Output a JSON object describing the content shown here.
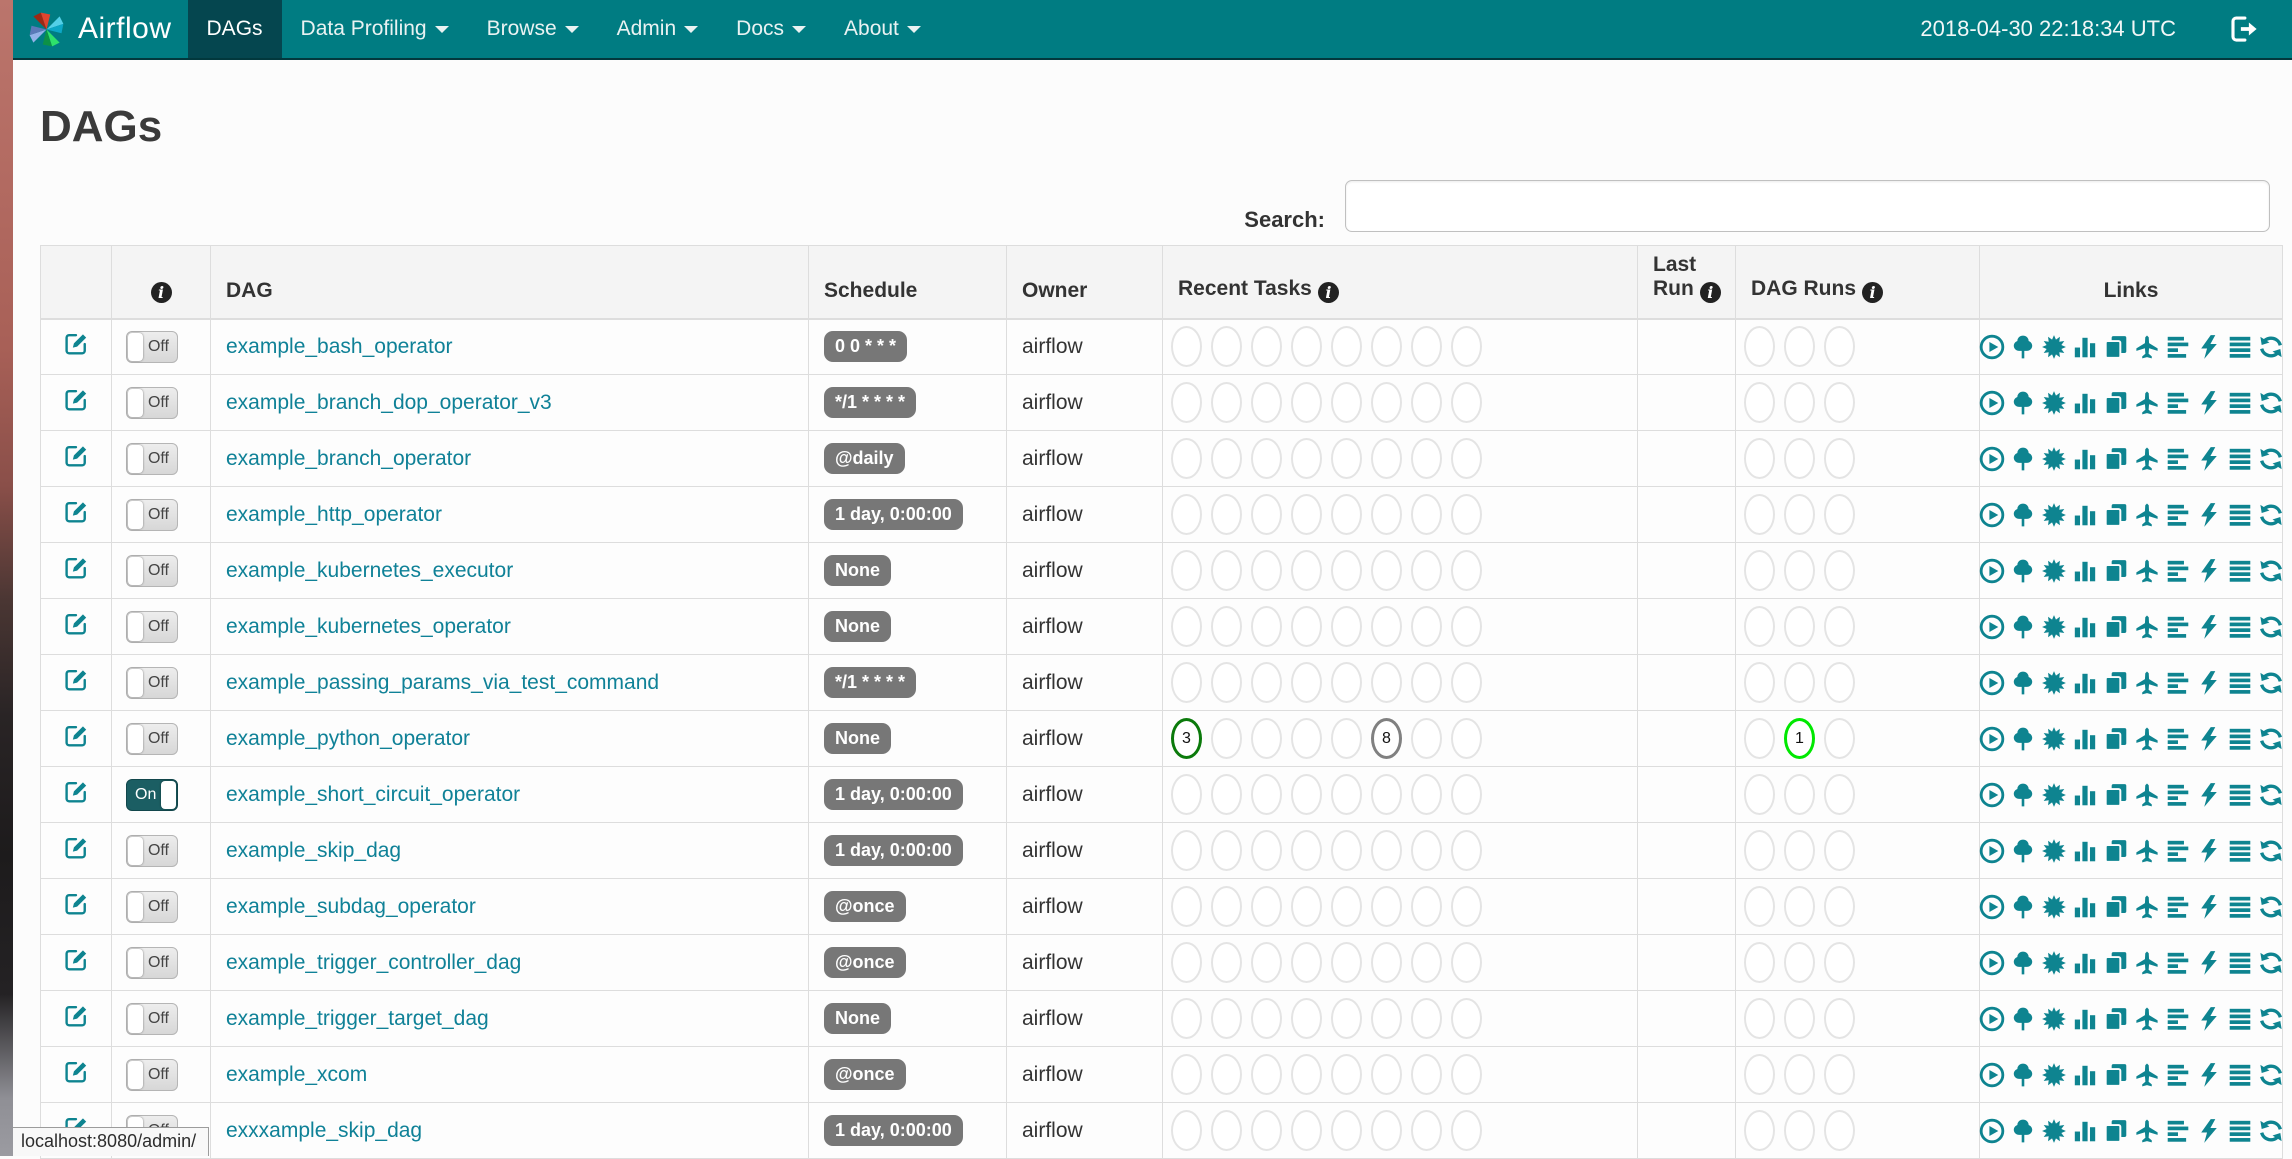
{
  "navbar": {
    "brand": "Airflow",
    "items": [
      {
        "label": "DAGs",
        "active": true,
        "caret": false
      },
      {
        "label": "Data Profiling",
        "active": false,
        "caret": true
      },
      {
        "label": "Browse",
        "active": false,
        "caret": true
      },
      {
        "label": "Admin",
        "active": false,
        "caret": true
      },
      {
        "label": "Docs",
        "active": false,
        "caret": true
      },
      {
        "label": "About",
        "active": false,
        "caret": true
      }
    ],
    "clock": "2018-04-30 22:18:34 UTC",
    "logout_icon": "sign-out-icon"
  },
  "page": {
    "title": "DAGs",
    "search_label": "Search:",
    "search_value": ""
  },
  "table": {
    "headers": {
      "info_icon": "info-icon",
      "dag": "DAG",
      "schedule": "Schedule",
      "owner": "Owner",
      "recent_tasks": "Recent Tasks",
      "last_run": "Last Run",
      "dag_runs": "DAG Runs",
      "links": "Links"
    },
    "recent_task_circle_count": 8,
    "dag_run_circle_count": 3,
    "link_icons": [
      {
        "name": "trigger-dag-icon",
        "symbol": "sym-play-circle"
      },
      {
        "name": "tree-view-icon",
        "symbol": "sym-tree"
      },
      {
        "name": "graph-view-icon",
        "symbol": "sym-starburst"
      },
      {
        "name": "task-duration-icon",
        "symbol": "sym-bar-chart"
      },
      {
        "name": "task-tries-icon",
        "symbol": "sym-pages"
      },
      {
        "name": "landing-times-icon",
        "symbol": "sym-plane"
      },
      {
        "name": "gantt-view-icon",
        "symbol": "sym-align-left"
      },
      {
        "name": "code-view-icon",
        "symbol": "sym-bolt"
      },
      {
        "name": "task-instances-icon",
        "symbol": "sym-justify"
      },
      {
        "name": "refresh-icon",
        "symbol": "sym-refresh"
      }
    ],
    "rows": [
      {
        "name": "example_bash_operator",
        "toggle": "Off",
        "schedule": "0 0 * * *",
        "owner": "airflow",
        "last_run": "",
        "recent_tasks": [],
        "dag_runs": []
      },
      {
        "name": "example_branch_dop_operator_v3",
        "toggle": "Off",
        "schedule": "*/1 * * * *",
        "owner": "airflow",
        "last_run": "",
        "recent_tasks": [],
        "dag_runs": []
      },
      {
        "name": "example_branch_operator",
        "toggle": "Off",
        "schedule": "@daily",
        "owner": "airflow",
        "last_run": "",
        "recent_tasks": [],
        "dag_runs": []
      },
      {
        "name": "example_http_operator",
        "toggle": "Off",
        "schedule": "1 day, 0:00:00",
        "owner": "airflow",
        "last_run": "",
        "recent_tasks": [],
        "dag_runs": []
      },
      {
        "name": "example_kubernetes_executor",
        "toggle": "Off",
        "schedule": "None",
        "owner": "airflow",
        "last_run": "",
        "recent_tasks": [],
        "dag_runs": []
      },
      {
        "name": "example_kubernetes_operator",
        "toggle": "Off",
        "schedule": "None",
        "owner": "airflow",
        "last_run": "",
        "recent_tasks": [],
        "dag_runs": []
      },
      {
        "name": "example_passing_params_via_test_command",
        "toggle": "Off",
        "schedule": "*/1 * * * *",
        "owner": "airflow",
        "last_run": "",
        "recent_tasks": [],
        "dag_runs": []
      },
      {
        "name": "example_python_operator",
        "toggle": "Off",
        "schedule": "None",
        "owner": "airflow",
        "last_run": "",
        "recent_tasks": [
          {
            "index": 0,
            "count": 3,
            "state": "success",
            "color": "#0b7a0b"
          },
          {
            "index": 5,
            "count": 8,
            "state": "queued",
            "color": "#808080"
          }
        ],
        "dag_runs": [
          {
            "index": 1,
            "count": 1,
            "state": "running",
            "color": "#00e800"
          }
        ]
      },
      {
        "name": "example_short_circuit_operator",
        "toggle": "On",
        "schedule": "1 day, 0:00:00",
        "owner": "airflow",
        "last_run": "",
        "recent_tasks": [],
        "dag_runs": []
      },
      {
        "name": "example_skip_dag",
        "toggle": "Off",
        "schedule": "1 day, 0:00:00",
        "owner": "airflow",
        "last_run": "",
        "recent_tasks": [],
        "dag_runs": []
      },
      {
        "name": "example_subdag_operator",
        "toggle": "Off",
        "schedule": "@once",
        "owner": "airflow",
        "last_run": "",
        "recent_tasks": [],
        "dag_runs": []
      },
      {
        "name": "example_trigger_controller_dag",
        "toggle": "Off",
        "schedule": "@once",
        "owner": "airflow",
        "last_run": "",
        "recent_tasks": [],
        "dag_runs": []
      },
      {
        "name": "example_trigger_target_dag",
        "toggle": "Off",
        "schedule": "None",
        "owner": "airflow",
        "last_run": "",
        "recent_tasks": [],
        "dag_runs": []
      },
      {
        "name": "example_xcom",
        "toggle": "Off",
        "schedule": "@once",
        "owner": "airflow",
        "last_run": "",
        "recent_tasks": [],
        "dag_runs": []
      },
      {
        "name": "exxxample_skip_dag",
        "toggle": "Off",
        "schedule": "1 day, 0:00:00",
        "owner": "airflow",
        "last_run": "",
        "recent_tasks": [],
        "dag_runs": []
      }
    ]
  },
  "status_bar": {
    "text": "localhost:8080/admin/"
  },
  "colors": {
    "navbar": "#007C82",
    "navbar_active": "#05464F",
    "accent": "#0E8490",
    "dag_link": "#0F8197",
    "badge": "#777777",
    "toggle_on": "#1B5E63",
    "state_success": "#0b7a0b",
    "state_running": "#00e800",
    "state_queued": "#808080",
    "circle_empty_border": "#e4e4e4"
  }
}
